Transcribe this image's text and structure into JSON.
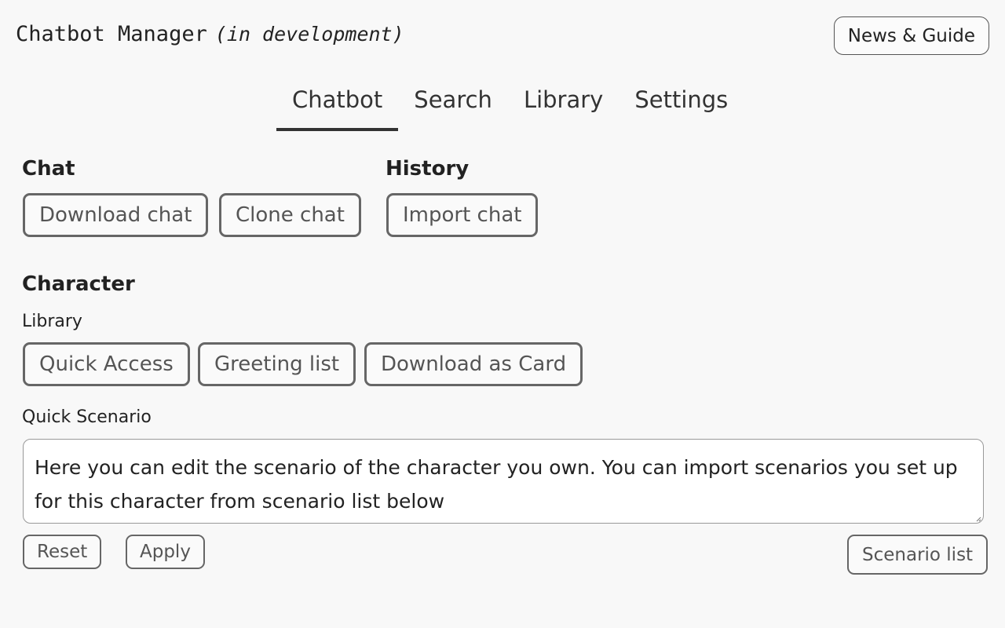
{
  "header": {
    "title": "Chatbot Manager",
    "subtitle": "(in development)",
    "news_button": "News & Guide"
  },
  "tabs": [
    {
      "label": "Chatbot",
      "active": true
    },
    {
      "label": "Search",
      "active": false
    },
    {
      "label": "Library",
      "active": false
    },
    {
      "label": "Settings",
      "active": false
    }
  ],
  "chat": {
    "heading": "Chat",
    "download_button": "Download chat",
    "clone_button": "Clone chat"
  },
  "history": {
    "heading": "History",
    "import_button": "Import chat"
  },
  "character": {
    "heading": "Character",
    "library_label": "Library",
    "quick_access_button": "Quick Access",
    "greeting_list_button": "Greeting list",
    "download_card_button": "Download as Card",
    "quick_scenario_label": "Quick Scenario",
    "scenario_text": "Here you can edit the scenario of the character you own. You can import scenarios you set up for this character from scenario list below",
    "reset_button": "Reset",
    "apply_button": "Apply",
    "scenario_list_button": "Scenario list"
  }
}
